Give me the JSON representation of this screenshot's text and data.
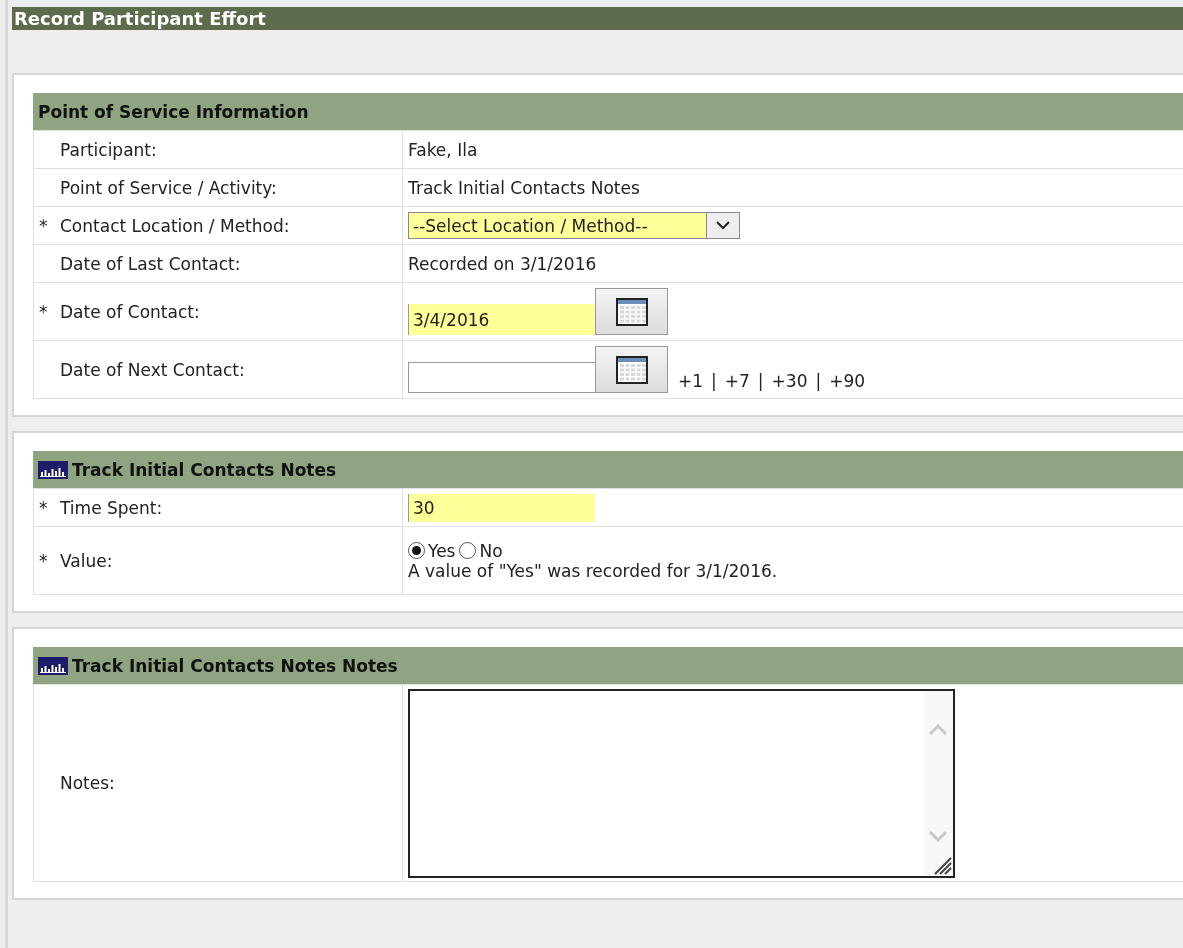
{
  "title": "Record Participant Effort",
  "sections": [
    {
      "has_icon": false,
      "title": "Point of Service Information",
      "rows": [
        {
          "kind": "text",
          "marker": "",
          "label": "Participant:",
          "value": "Fake, Ila"
        },
        {
          "kind": "text",
          "marker": "",
          "label": "Point of Service / Activity:",
          "value": "Track Initial Contacts Notes"
        },
        {
          "kind": "select",
          "marker": "*",
          "label": "Contact Location / Method:",
          "value": "--Select Location / Method--",
          "highlighted": true
        },
        {
          "kind": "text",
          "marker": "",
          "label": "Date of Last Contact:",
          "value": "Recorded on 3/1/2016"
        },
        {
          "kind": "date",
          "marker": "*",
          "label": "Date of Contact:",
          "value": "3/4/2016",
          "highlighted": true
        },
        {
          "kind": "date",
          "marker": "",
          "label": "Date of Next Contact:",
          "value": "",
          "highlighted": false,
          "quick_links": [
            "+1",
            "+7",
            "+30",
            "+90"
          ],
          "separator": "|"
        }
      ]
    },
    {
      "has_icon": true,
      "title": "Track Initial Contacts Notes",
      "rows": [
        {
          "kind": "input",
          "marker": "*",
          "label": "Time Spent:",
          "value": "30",
          "highlighted": true
        },
        {
          "kind": "radio",
          "marker": "*",
          "label": "Value:",
          "options": [
            {
              "label": "Yes",
              "selected": true
            },
            {
              "label": "No",
              "selected": false
            }
          ],
          "note": "A value of \"Yes\" was recorded for 3/1/2016."
        }
      ]
    },
    {
      "has_icon": true,
      "title": "Track Initial Contacts Notes Notes",
      "rows": [
        {
          "kind": "textarea",
          "marker": "",
          "label": "Notes:",
          "value": ""
        }
      ]
    }
  ]
}
